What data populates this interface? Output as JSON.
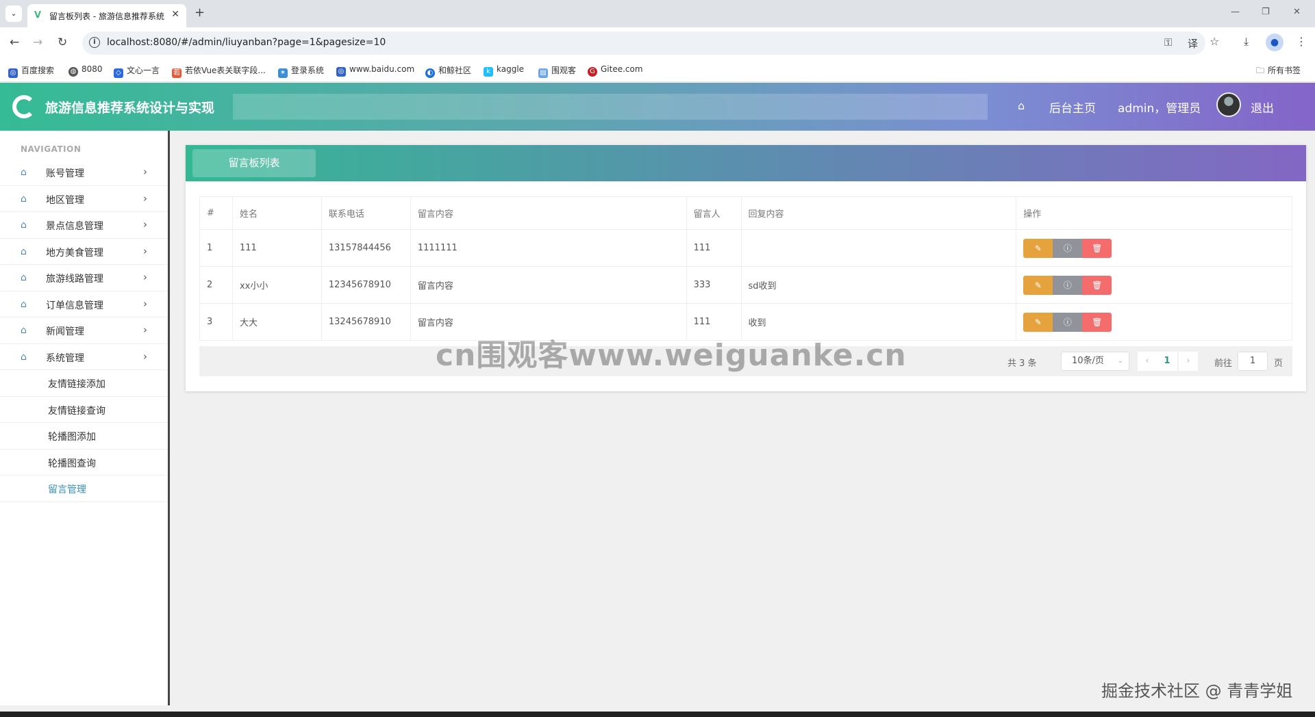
{
  "browser": {
    "tab_title": "留言板列表 - 旅游信息推荐系统",
    "url": "localhost:8080/#/admin/liuyanban?page=1&pagesize=10",
    "bookmarks": [
      {
        "label": "百度搜索",
        "color": "#3264c8"
      },
      {
        "label": "8080",
        "color": "#555555"
      },
      {
        "label": "文心一言",
        "color": "#2d6ae0"
      },
      {
        "label": "若依Vue表关联字段...",
        "color": "#e65a3c"
      },
      {
        "label": "登录系统",
        "color": "#3a8fd6"
      },
      {
        "label": "www.baidu.com",
        "color": "#3264c8"
      },
      {
        "label": "和鲸社区",
        "color": "#1e6fd9"
      },
      {
        "label": "kaggle",
        "color": "#20beff"
      },
      {
        "label": "围观客",
        "color": "#6aa6e6"
      },
      {
        "label": "Gitee.com",
        "color": "#c71d23"
      }
    ],
    "all_bookmarks": "所有书签"
  },
  "header": {
    "title": "旅游信息推荐系统设计与实现",
    "home_link": "后台主页",
    "user_label": "admin，管理员",
    "logout": "退出"
  },
  "sidebar": {
    "nav_title": "NAVIGATION",
    "items": [
      {
        "label": "账号管理"
      },
      {
        "label": "地区管理"
      },
      {
        "label": "景点信息管理"
      },
      {
        "label": "地方美食管理"
      },
      {
        "label": "旅游线路管理"
      },
      {
        "label": "订单信息管理"
      },
      {
        "label": "新闻管理"
      },
      {
        "label": "系统管理"
      }
    ],
    "sub_items": [
      {
        "label": "友情链接添加"
      },
      {
        "label": "友情链接查询"
      },
      {
        "label": "轮播图添加"
      },
      {
        "label": "轮播图查询"
      },
      {
        "label": "留言管理"
      }
    ]
  },
  "panel": {
    "tab_label": "留言板列表",
    "columns": [
      "#",
      "姓名",
      "联系电话",
      "留言内容",
      "留言人",
      "回复内容",
      "操作"
    ],
    "rows": [
      {
        "idx": "1",
        "name": "111",
        "phone": "13157844456",
        "content": "1111111",
        "author": "111",
        "reply": ""
      },
      {
        "idx": "2",
        "name": "xx小小",
        "phone": "12345678910",
        "content": "留言内容",
        "author": "333",
        "reply": "sd收到"
      },
      {
        "idx": "3",
        "name": "大大",
        "phone": "13245678910",
        "content": "留言内容",
        "author": "111",
        "reply": "收到"
      }
    ]
  },
  "pagination": {
    "total": "共 3 条",
    "page_size": "10条/页",
    "current_page": "1",
    "goto_label": "前往",
    "goto_value": "1",
    "goto_unit": "页"
  },
  "watermark": "cn围观客www.weiguanke.cn",
  "credit": "掘金技术社区 @ 青青学姐",
  "colors": {
    "edit": "#e6a23c",
    "info": "#909399",
    "delete": "#f56c6c",
    "accent": "#35bb95"
  }
}
